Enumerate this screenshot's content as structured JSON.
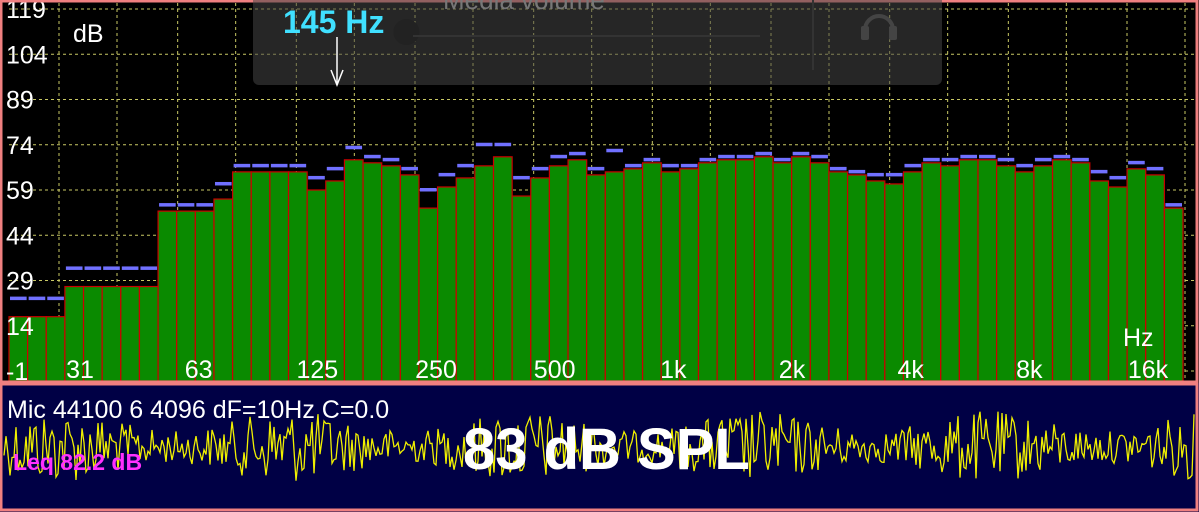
{
  "toast": {
    "title": "Media volume",
    "volume_fraction": 0.03,
    "icon": "headphones-icon"
  },
  "peak": {
    "label": "145 Hz",
    "frequency_hz": 145
  },
  "chart_data": {
    "type": "bar",
    "ylabel": "dB",
    "xlabel": "Hz",
    "ylim": [
      -1,
      119
    ],
    "yticks": [
      -1,
      14,
      29,
      44,
      59,
      74,
      89,
      104,
      119
    ],
    "xtick_labels": [
      "31",
      "63",
      "125",
      "250",
      "500",
      "1k",
      "2k",
      "4k",
      "8k",
      "16k"
    ],
    "grid": true,
    "series": [
      {
        "values": [
          17,
          17,
          17,
          27,
          27,
          27,
          27,
          27,
          52,
          52,
          52,
          56,
          65,
          65,
          65,
          65,
          59,
          62,
          69,
          68,
          67,
          64,
          53,
          60,
          63,
          67,
          70,
          57,
          63,
          67,
          69,
          64,
          65,
          66,
          68,
          65,
          66,
          68,
          69,
          69,
          70,
          68,
          70,
          68,
          65,
          64,
          62,
          61,
          65,
          68,
          67,
          69,
          69,
          67,
          65,
          67,
          69,
          68,
          62,
          60,
          66,
          64,
          53
        ]
      },
      {
        "values": [
          23,
          23,
          23,
          33,
          33,
          33,
          33,
          33,
          54,
          54,
          54,
          61,
          67,
          67,
          67,
          67,
          63,
          66,
          73,
          70,
          69,
          66,
          59,
          64,
          67,
          74,
          74,
          63,
          66,
          70,
          71,
          66,
          72,
          67,
          69,
          67,
          67,
          69,
          70,
          70,
          71,
          69,
          71,
          70,
          66,
          65,
          64,
          64,
          67,
          69,
          69,
          70,
          70,
          69,
          67,
          69,
          70,
          69,
          65,
          63,
          68,
          66,
          54
        ]
      }
    ]
  },
  "info": {
    "mic_text": "Mic 44100 6 4096 dF=10Hz C=0.0",
    "leq_text": "Leq  82.2 dB",
    "spl_text": "83 dB SPL"
  },
  "colors": {
    "bar_fill": "#0a8a00",
    "bar_edge": "#cc0000",
    "peak_marker": "#7070ff",
    "grid": "#c8c864",
    "frame": "#f08080",
    "wave": "#f0f000",
    "panel_bg": "#000045",
    "peak_label": "#40e0ff",
    "leq": "#ff30ff"
  }
}
